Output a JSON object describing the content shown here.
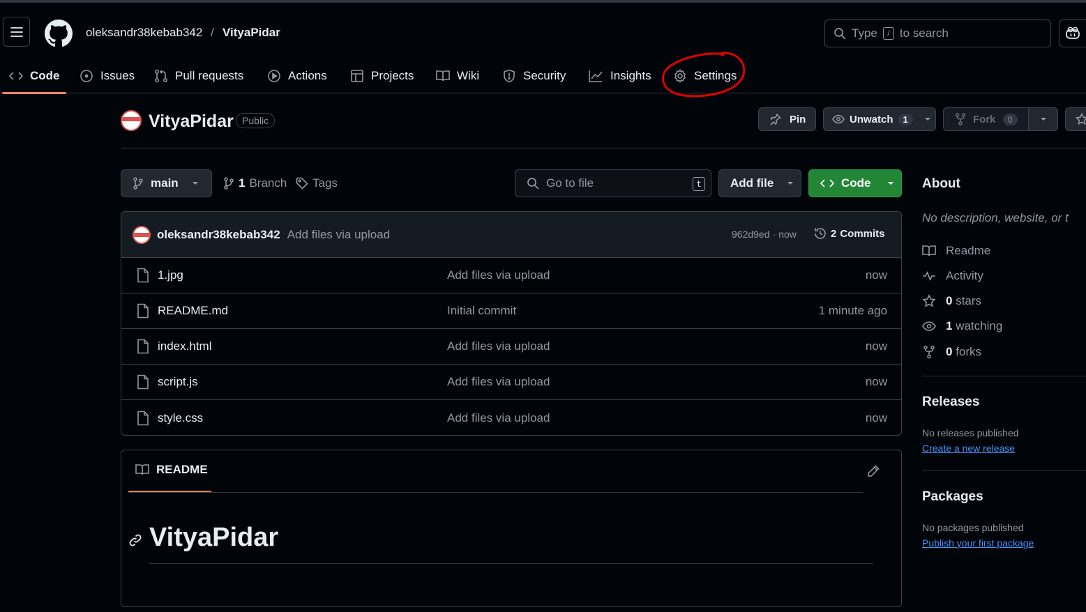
{
  "header": {
    "owner": "oleksandr38kebab342",
    "separator": "/",
    "repo": "VityaPidar",
    "search_prefix": "Type",
    "search_key": "/",
    "search_suffix": "to search"
  },
  "nav_tabs": [
    {
      "label": "Code",
      "icon": "code-icon",
      "active": true
    },
    {
      "label": "Issues",
      "icon": "issue-opened-icon"
    },
    {
      "label": "Pull requests",
      "icon": "git-pull-request-icon"
    },
    {
      "label": "Actions",
      "icon": "play-icon"
    },
    {
      "label": "Projects",
      "icon": "table-icon"
    },
    {
      "label": "Wiki",
      "icon": "book-icon"
    },
    {
      "label": "Security",
      "icon": "shield-icon"
    },
    {
      "label": "Insights",
      "icon": "graph-icon"
    },
    {
      "label": "Settings",
      "icon": "gear-icon",
      "annotated": true
    }
  ],
  "repo_header": {
    "name": "VityaPidar",
    "visibility": "Public",
    "pin_label": "Pin",
    "unwatch_label": "Unwatch",
    "watch_count": "1",
    "fork_label": "Fork",
    "fork_count": "0"
  },
  "toolbar": {
    "branch": "main",
    "branch_count": "1",
    "branch_label": "Branch",
    "tags_label": "Tags",
    "goto_placeholder": "Go to file",
    "goto_key": "t",
    "add_file_label": "Add file",
    "code_label": "Code"
  },
  "latest_commit": {
    "author": "oleksandr38kebab342",
    "message": "Add files via upload",
    "hash": "962d9ed",
    "time_sep": "·",
    "time": "now",
    "commits_count": "2",
    "commits_label": "Commits"
  },
  "files": [
    {
      "name": "1.jpg",
      "message": "Add files via upload",
      "time": "now"
    },
    {
      "name": "README.md",
      "message": "Initial commit",
      "time": "1 minute ago"
    },
    {
      "name": "index.html",
      "message": "Add files via upload",
      "time": "now"
    },
    {
      "name": "script.js",
      "message": "Add files via upload",
      "time": "now"
    },
    {
      "name": "style.css",
      "message": "Add files via upload",
      "time": "now"
    }
  ],
  "readme": {
    "tab_label": "README",
    "heading": "VityaPidar"
  },
  "about": {
    "title": "About",
    "description": "No description, website, or t",
    "readme": "Readme",
    "activity": "Activity",
    "stars_count": "0",
    "stars_label": "stars",
    "watching_count": "1",
    "watching_label": "watching",
    "forks_count": "0",
    "forks_label": "forks"
  },
  "releases": {
    "title": "Releases",
    "empty": "No releases published",
    "link": "Create a new release"
  },
  "packages": {
    "title": "Packages",
    "empty": "No packages published",
    "link": "Publish your first package"
  },
  "colors": {
    "background": "#010409",
    "accent_green": "#238636",
    "active_tab_underline": "#f78166",
    "link": "#4493f8",
    "annotation": "#e00000"
  }
}
